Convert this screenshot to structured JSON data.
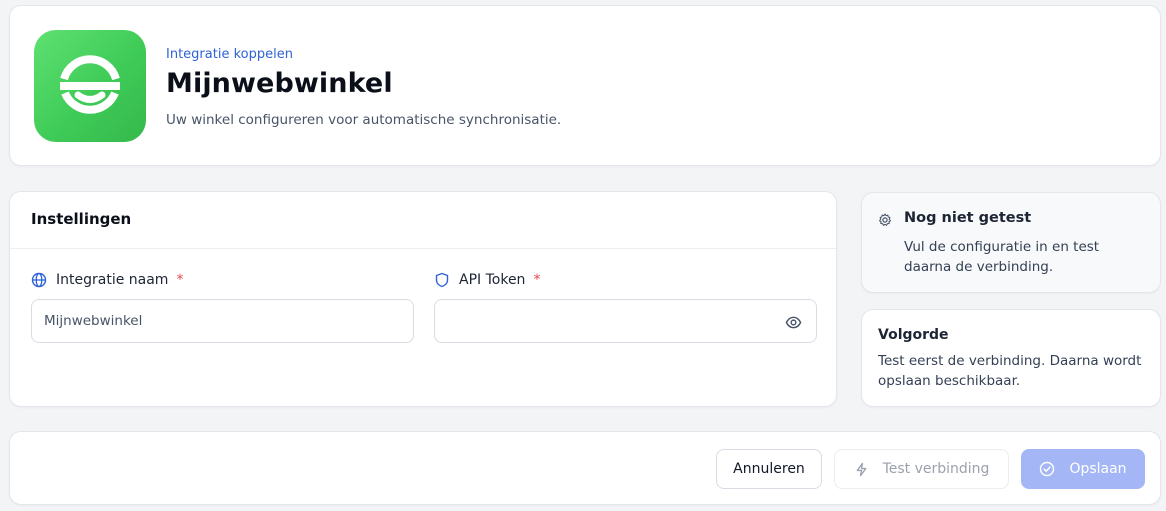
{
  "header": {
    "eyebrow": "Integratie koppelen",
    "title": "Mijnwebwinkel",
    "subtitle": "Uw winkel configureren voor automatische synchronisatie.",
    "logo_icon": "mijnwebwinkel-logo",
    "logo_color": "#3fcb57"
  },
  "settings": {
    "title": "Instellingen",
    "fields": [
      {
        "label": "Integratie naam",
        "required_mark": "*",
        "icon": "globe-icon",
        "value": "Mijnwebwinkel",
        "placeholder": ""
      },
      {
        "label": "API Token",
        "required_mark": "*",
        "icon": "shield-icon",
        "value": "",
        "placeholder": "",
        "trailing_icon": "eye-icon"
      }
    ]
  },
  "status": {
    "icon": "gear-icon",
    "title": "Nog niet getest",
    "text": "Vul de configuratie in en test daarna de verbinding."
  },
  "order": {
    "title": "Volgorde",
    "text": "Test eerst de verbinding. Daarna wordt opslaan beschikbaar."
  },
  "footer": {
    "cancel_label": "Annuleren",
    "test_label": "Test verbinding",
    "test_icon": "bolt-icon",
    "save_label": "Opslaan",
    "save_icon": "check-circle-icon",
    "accent_color": "#a4b6f5"
  }
}
